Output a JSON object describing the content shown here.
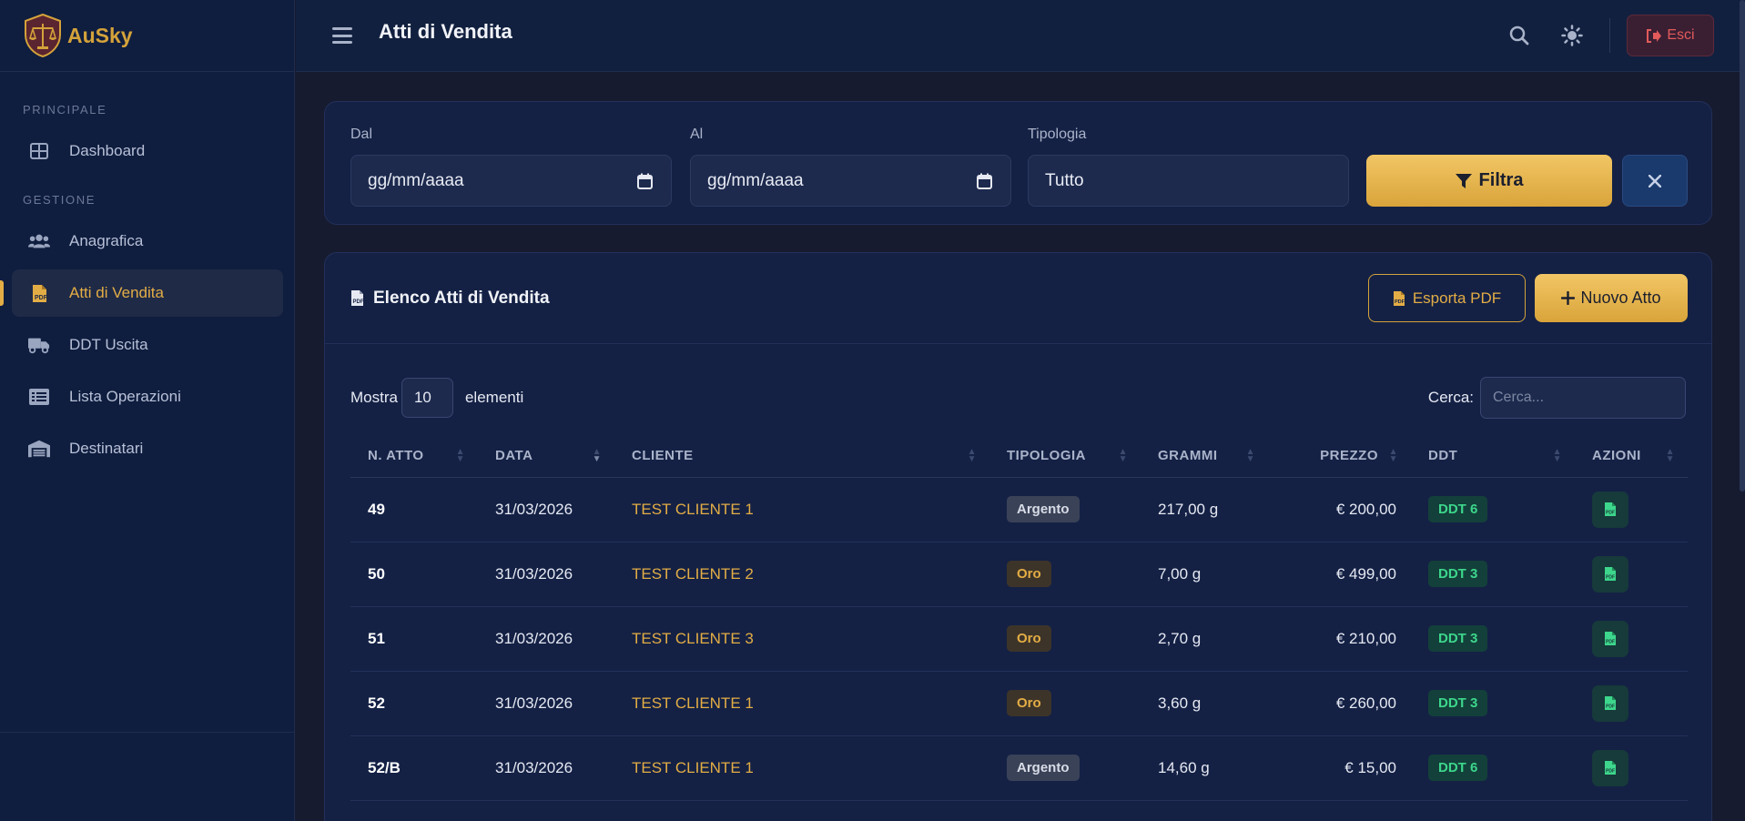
{
  "brand": {
    "name": "AuSky"
  },
  "sidebar": {
    "sections": [
      {
        "title": "PRINCIPALE"
      },
      {
        "title": "GESTIONE"
      }
    ],
    "items": [
      {
        "label": "Dashboard",
        "icon": "dashboard-icon"
      },
      {
        "label": "Anagrafica",
        "icon": "users-icon"
      },
      {
        "label": "Atti di Vendita",
        "icon": "file-pdf-icon",
        "active": true
      },
      {
        "label": "DDT Uscita",
        "icon": "truck-icon"
      },
      {
        "label": "Lista Operazioni",
        "icon": "list-icon"
      },
      {
        "label": "Destinatari",
        "icon": "warehouse-icon"
      }
    ]
  },
  "header": {
    "title": "Atti di Vendita",
    "exit_label": "Esci"
  },
  "filter": {
    "from_label": "Dal",
    "from_value": "gg/mm/aaaa",
    "to_label": "Al",
    "to_value": "gg/mm/aaaa",
    "type_label": "Tipologia",
    "type_value": "Tutto",
    "submit_label": "Filtra"
  },
  "list": {
    "title": "Elenco Atti di Vendita",
    "export_label": "Esporta PDF",
    "new_label": "Nuovo Atto",
    "show_label": "Mostra",
    "page_length": "10",
    "elements_label": "elementi",
    "search_label": "Cerca:",
    "search_placeholder": "Cerca...",
    "columns": [
      "N. ATTO",
      "DATA",
      "CLIENTE",
      "TIPOLOGIA",
      "GRAMMI",
      "PREZZO",
      "DDT",
      "AZIONI"
    ],
    "rows": [
      {
        "n": "49",
        "data": "31/03/2026",
        "cliente": "TEST CLIENTE 1",
        "tipologia": "Argento",
        "grammi": "217,00 g",
        "prezzo": "€ 200,00",
        "ddt": "DDT 6"
      },
      {
        "n": "50",
        "data": "31/03/2026",
        "cliente": "TEST CLIENTE 2",
        "tipologia": "Oro",
        "grammi": "7,00 g",
        "prezzo": "€ 499,00",
        "ddt": "DDT 3"
      },
      {
        "n": "51",
        "data": "31/03/2026",
        "cliente": "TEST CLIENTE 3",
        "tipologia": "Oro",
        "grammi": "2,70 g",
        "prezzo": "€ 210,00",
        "ddt": "DDT 3"
      },
      {
        "n": "52",
        "data": "31/03/2026",
        "cliente": "TEST CLIENTE 1",
        "tipologia": "Oro",
        "grammi": "3,60 g",
        "prezzo": "€ 260,00",
        "ddt": "DDT 3"
      },
      {
        "n": "52/B",
        "data": "31/03/2026",
        "cliente": "TEST CLIENTE 1",
        "tipologia": "Argento",
        "grammi": "14,60 g",
        "prezzo": "€ 15,00",
        "ddt": "DDT 6"
      }
    ]
  },
  "colors": {
    "accent": "#e3ad45",
    "danger": "#e25a5a",
    "success": "#3dd68c",
    "background": "#161b30"
  }
}
